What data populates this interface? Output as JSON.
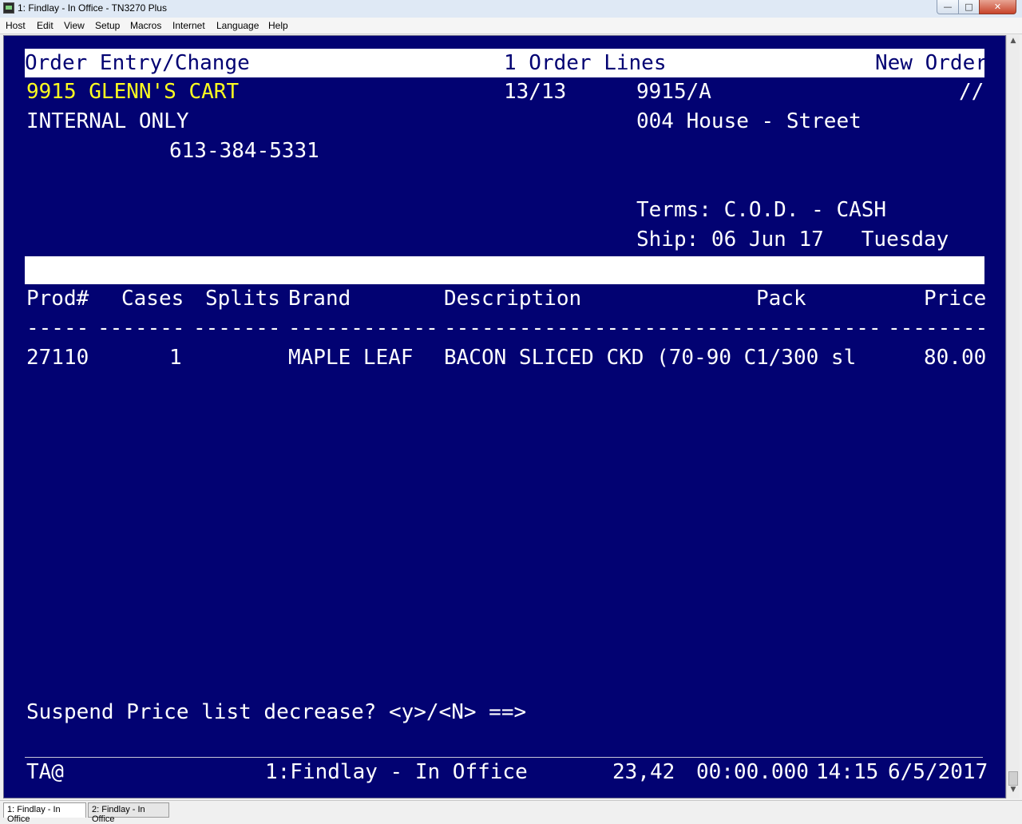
{
  "window": {
    "title": "1: Findlay - In Office - TN3270 Plus",
    "buttons": {
      "minimize": "—",
      "maximize": "□",
      "close": "✕"
    }
  },
  "menu": [
    "Host",
    "Edit",
    "View",
    "Setup",
    "Macros",
    "Internet",
    "Language",
    "Help"
  ],
  "screen": {
    "header": {
      "title": "Order Entry/Change",
      "section": "1 Order Lines",
      "mode": "New Order"
    },
    "customer": {
      "name": "9915 GLENN'S CART",
      "count": "13/13",
      "account": "9915/A",
      "slashes": "//"
    },
    "line2": {
      "left": "INTERNAL ONLY",
      "right": "004 House - Street"
    },
    "phone": "613-384-5331",
    "terms": "Terms: C.O.D. - CASH",
    "ship": "Ship: 06 Jun 17   Tuesday",
    "columns": {
      "prod": "Prod#",
      "cases": "Cases",
      "splits": "Splits",
      "brand": "Brand",
      "description": "Description",
      "pack": "Pack",
      "price": "Price"
    },
    "dashes": {
      "prod": "-----",
      "cases": "-------",
      "splits": "-------",
      "brand": "------------",
      "description": "-------------------------",
      "pack": "----------",
      "price": "--------"
    },
    "rows": [
      {
        "prod": "27110",
        "cases": "1",
        "splits": "",
        "brand": "MAPLE LEAF",
        "description": "BACON SLICED CKD (70-90 C",
        "pack": "1/300 sl",
        "price": "80.00"
      }
    ],
    "prompt": "Suspend Price list decrease? <y>/<N> ==>",
    "status": {
      "left": "TA@",
      "session": "1:Findlay - In Office",
      "cursor": "23,42",
      "timer": "00:00.000",
      "time": "14:15",
      "date": "6/5/2017"
    }
  },
  "tabs": [
    "1: Findlay - In Office",
    "2: Findlay - In Office"
  ],
  "colors": {
    "terminal_bg": "#020272",
    "highlight_text": "#ffff20",
    "text": "#ffffff"
  }
}
